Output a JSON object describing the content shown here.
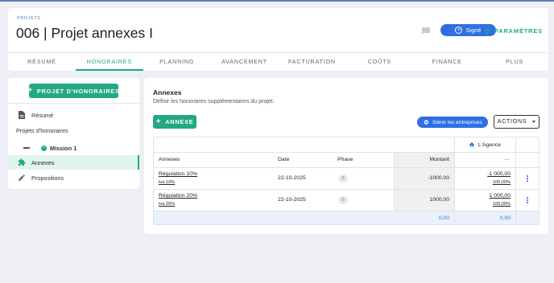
{
  "header": {
    "kicker": "PROJETS",
    "title": "006 | Projet annexes I",
    "status_label": "Signé",
    "params_label": "PARAMÈTRES",
    "colors": {
      "accent": "#22a884",
      "primary": "#2f6fe4"
    }
  },
  "tabs": [
    {
      "label": "RÉSUMÉ"
    },
    {
      "label": "HONORAIRES",
      "active": true
    },
    {
      "label": "PLANNING"
    },
    {
      "label": "AVANCEMENT"
    },
    {
      "label": "FACTURATION"
    },
    {
      "label": "COÛTS"
    },
    {
      "label": "FINANCE"
    },
    {
      "label": "PLUS"
    }
  ],
  "sidebar": {
    "project_button": "PROJET D'HONORAIRES",
    "resume_label": "Résumé",
    "heading": "Projets d'honoraires",
    "mission_label": "Mission 1",
    "annexes_label": "Annexes",
    "propositions_label": "Propositions"
  },
  "main": {
    "title": "Annexes",
    "subtitle": "Définir les honoraires supplémentaires du projet.",
    "add_button": "ANNEXE",
    "entreprises_button": "Gérer les entreprises",
    "actions_button": "ACTIONS",
    "table": {
      "agency_header": "L'Agence",
      "agency_sub": "---",
      "columns": {
        "annexes": "Annexes",
        "date": "Date",
        "phase": "Phase",
        "montant": "Montant"
      },
      "rows": [
        {
          "name": "Régulation 10%",
          "tva": "tva 10%",
          "date": "22-10-2025",
          "phase": "0",
          "montant": "-1000,00",
          "agency_value": "-1 000,00",
          "agency_pct": "100,00%"
        },
        {
          "name": "Régulation 20%",
          "tva": "tva 20%",
          "date": "22-10-2025",
          "phase": "0",
          "montant": "1000,00",
          "agency_value": "1 000,00",
          "agency_pct": "100,00%"
        }
      ],
      "total_montant": "0,00",
      "total_agency": "0,00"
    }
  }
}
